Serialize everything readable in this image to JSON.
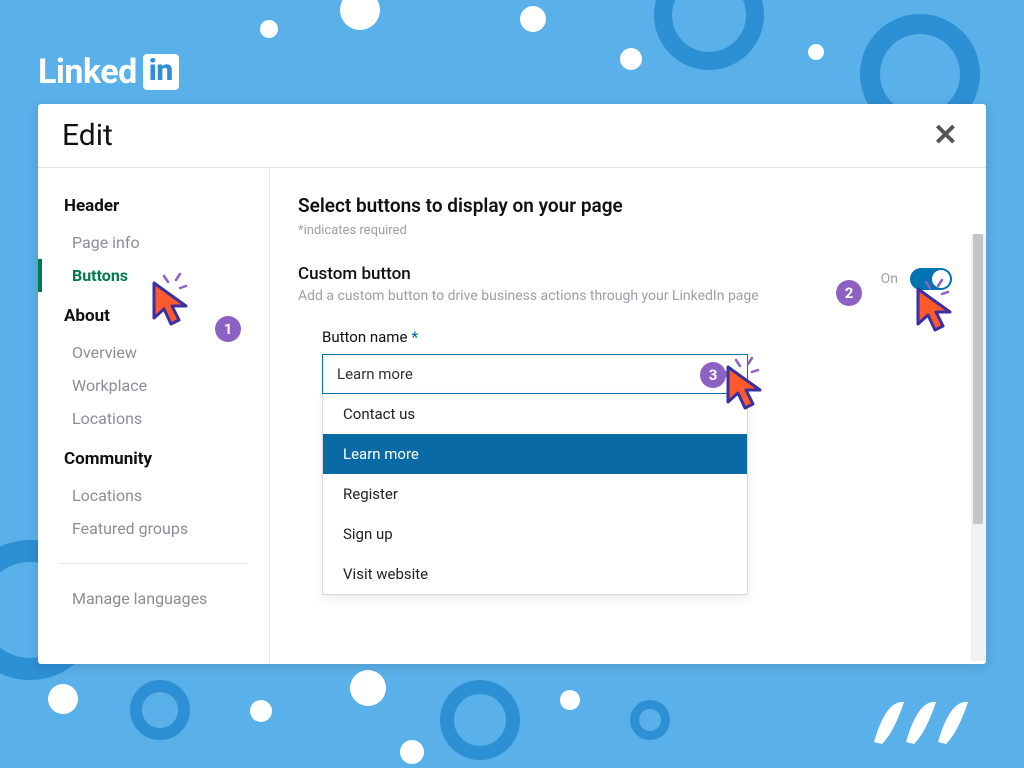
{
  "brand": {
    "word": "Linked",
    "box": "in"
  },
  "panel": {
    "title": "Edit"
  },
  "sidebar": {
    "sections": [
      {
        "title": "Header",
        "items": [
          "Page info",
          "Buttons"
        ]
      },
      {
        "title": "About",
        "items": [
          "Overview",
          "Workplace",
          "Locations"
        ]
      },
      {
        "title": "Community",
        "items": [
          "Locations",
          "Featured groups"
        ]
      }
    ],
    "manage": "Manage languages",
    "active": "Buttons"
  },
  "main": {
    "heading": "Select buttons to display on your page",
    "required_hint": "*indicates required",
    "custom_title": "Custom button",
    "custom_sub": "Add a custom button to drive business actions through your LinkedIn page",
    "toggle_label": "On",
    "field_label": "Button name",
    "selected": "Learn more",
    "options": [
      "Contact us",
      "Learn more",
      "Register",
      "Sign up",
      "Visit website"
    ]
  },
  "annotations": {
    "b1": "1",
    "b2": "2",
    "b3": "3"
  }
}
